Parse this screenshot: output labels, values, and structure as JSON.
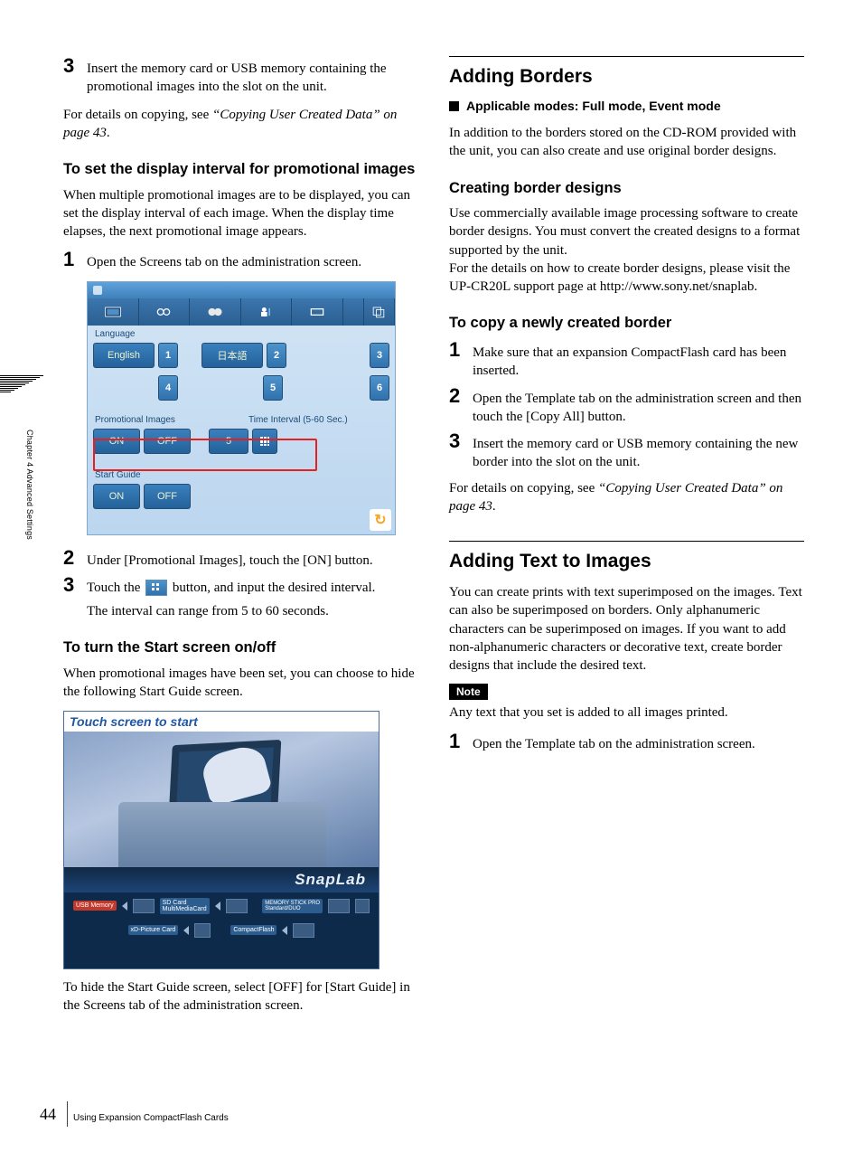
{
  "sidebar": {
    "chapter_label": "Chapter 4  Advanced Settings"
  },
  "footer": {
    "page_number": "44",
    "section": "Using Expansion CompactFlash Cards"
  },
  "left": {
    "step3_top": "Insert the memory card or USB memory containing the promotional images into the slot on the unit.",
    "details_prefix": "For details on copying, see ",
    "details_ref": "“Copying User Created Data” on page 43",
    "details_suffix": ".",
    "set_interval_heading": "To set the display interval for promotional images",
    "set_interval_body": "When multiple promotional images are to be displayed, you can set the display interval of each image. When the display time elapses, the next promotional image appears.",
    "step1_interval": "Open the Screens tab on the administration screen.",
    "admin": {
      "language_label": "Language",
      "english": "English",
      "japanese": "日本語",
      "n1": "1",
      "n2": "2",
      "n3": "3",
      "n4": "4",
      "n5": "5",
      "n6": "6",
      "promo_label": "Promotional Images",
      "time_label": "Time Interval (5-60 Sec.)",
      "on": "ON",
      "off": "OFF",
      "interval_value": "5",
      "start_guide_label": "Start Guide"
    },
    "step2_interval": "Under [Promotional Images], touch the [ON] button.",
    "step3a_interval": "Touch the ",
    "step3b_interval": " button, and input the desired interval.",
    "interval_range": "The interval can range from 5 to 60 seconds.",
    "start_screen_heading": "To turn the Start screen on/off",
    "start_screen_body": "When promotional images have been set, you can choose to hide the following Start Guide screen.",
    "start_shot": {
      "touch_text": "Touch screen to start",
      "logo": "SnapLab",
      "usb": "USB Memory",
      "sd": "SD Card\nMultiMediaCard",
      "ms": "MEMORY STICK PRO\nStandard/DUO",
      "xd": "xD-Picture Card",
      "cf": "CompactFlash"
    },
    "start_hide_body": "To hide the Start Guide screen, select [OFF] for [Start Guide] in the Screens tab of the administration screen."
  },
  "right": {
    "borders_heading": "Adding Borders",
    "modes_line": "Applicable modes: Full mode, Event mode",
    "borders_intro": "In addition to the borders stored on the CD-ROM provided with the unit, you can also create and use original border designs.",
    "creating_heading": "Creating border designs",
    "creating_body": "Use commercially available image processing software to create border designs. You must convert the created designs to a format supported by the unit.\nFor the details on how to create border designs, please visit the UP-CR20L support page at http://www.sony.net/snaplab.",
    "copy_heading": "To copy a newly created border",
    "copy_step1": "Make sure that an expansion CompactFlash card has been inserted.",
    "copy_step2": "Open the Template tab on the administration screen and then touch the [Copy All] button.",
    "copy_step3": "Insert the memory card or USB memory containing the new border into the slot on the unit.",
    "details_prefix": "For details on copying, see ",
    "details_ref": "“Copying User Created Data” on page 43",
    "details_suffix": ".",
    "text_heading": "Adding Text to Images",
    "text_body": "You can create prints with text superimposed on the images. Text can also be superimposed on borders. Only alphanumeric characters can be superimposed on images. If you want to add non-alphanumeric characters or decorative text, create border designs that include the desired text.",
    "note_label": "Note",
    "note_body": "Any text that you set is added to all images printed.",
    "text_step1": "Open the Template tab on the administration screen."
  }
}
